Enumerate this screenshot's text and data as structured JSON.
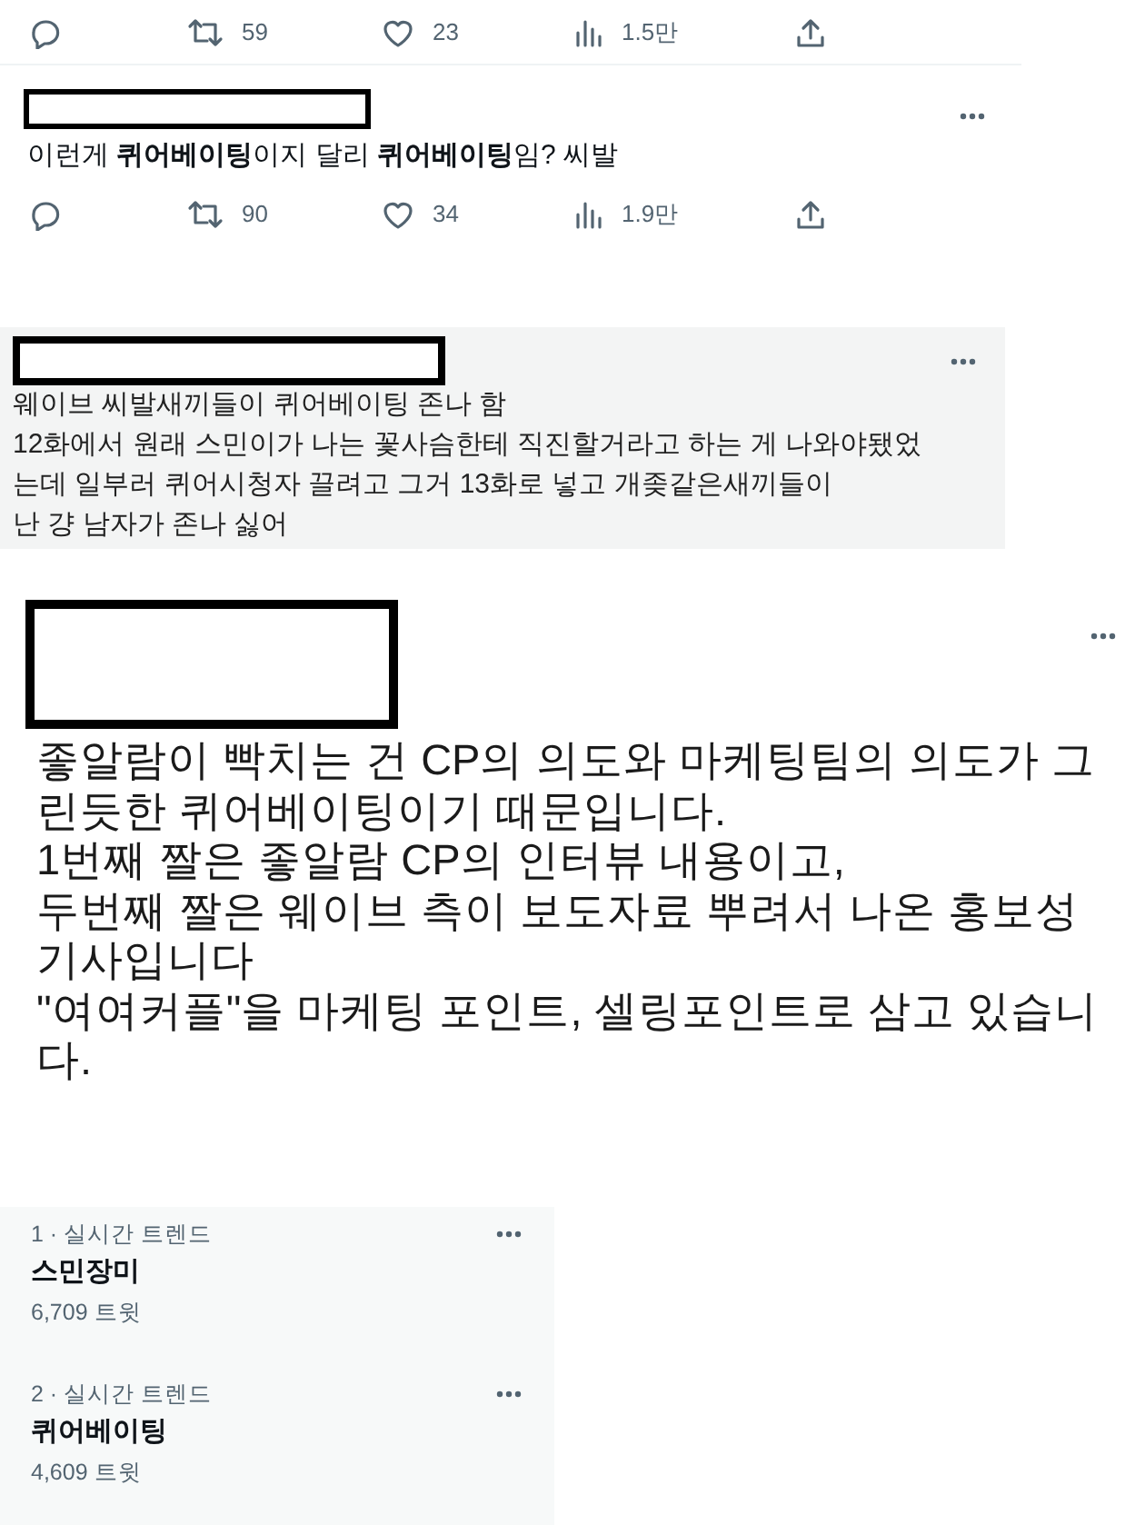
{
  "reply_thread": {
    "top_actions": [
      {
        "kind": "reply"
      },
      {
        "kind": "retweet",
        "count": "59"
      },
      {
        "kind": "like",
        "count": "23"
      },
      {
        "kind": "views",
        "count": "1.5만"
      },
      {
        "kind": "share"
      }
    ],
    "reply": {
      "text": "이런게 **퀴어베이팅**이지 달리 **퀴어베이팅**임? 씨발",
      "actions": [
        {
          "kind": "reply"
        },
        {
          "kind": "retweet",
          "count": "90"
        },
        {
          "kind": "like",
          "count": "34"
        },
        {
          "kind": "views",
          "count": "1.9만"
        },
        {
          "kind": "share"
        }
      ]
    }
  },
  "quoted_reply": {
    "text": "웨이브 씨발새끼들이 퀴어베이팅 존나 함\n12화에서 원래 스민이가 나는 꽃사슴한테 직진할거라고 하는 게 나와야됐었는데 일부러 퀴어시청자 끌려고 그거 13화로 넣고 개좆같은새끼들이\n난 걍 남자가 존나 싫어"
  },
  "post": {
    "text": "좋알람이 빡치는 건 CP의 의도와 마케팅팀의 의도가 그린듯한 퀴어베이팅이기 때문입니다.\n1번째 짤은 좋알람 CP의 인터뷰 내용이고,\n두번째 짤은 웨이브 측이 보도자료 뿌려서 나온 홍보성 기사입니다\n\"여여커플\"을 마케팅 포인트, 셀링포인트로 삼고 있습니다."
  },
  "trends": [
    {
      "rank": "1 · 실시간 트렌드",
      "name": "스민장미",
      "count": "6,709 트윗"
    },
    {
      "rank": "2 · 실시간 트렌드",
      "name": "퀴어베이팅",
      "count": "4,609 트윗"
    }
  ]
}
